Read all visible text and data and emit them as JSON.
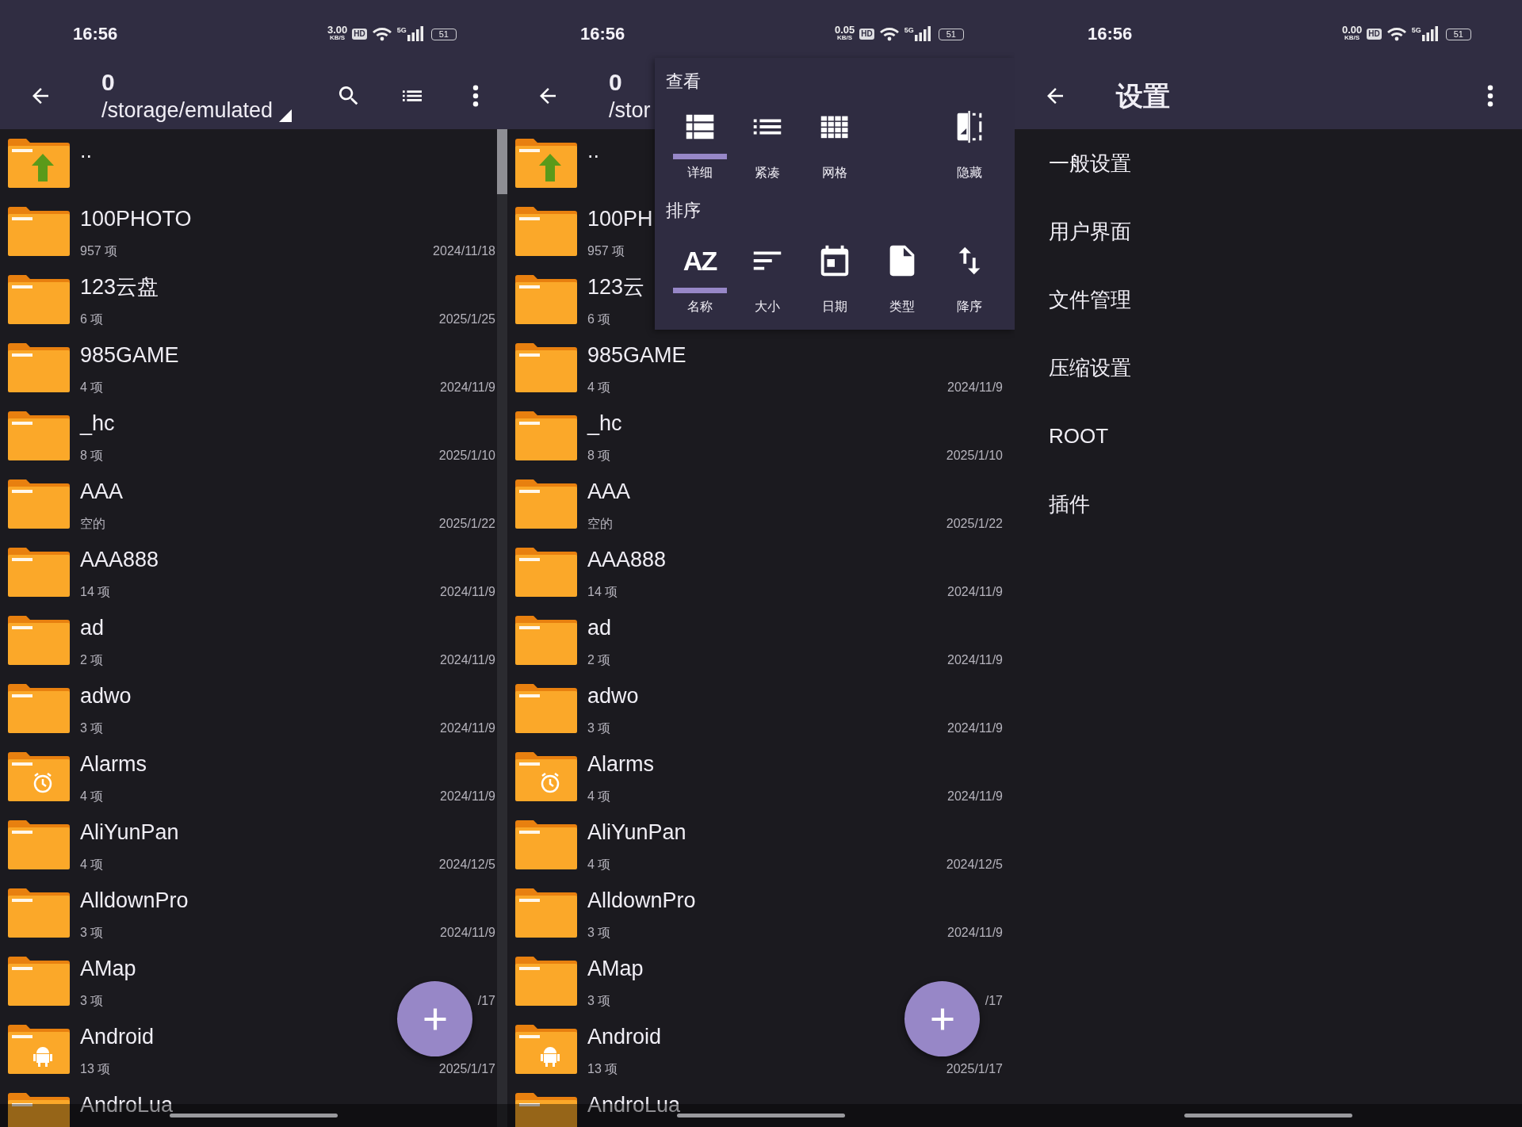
{
  "screens": [
    {
      "kind": "browser",
      "scrollbar": true,
      "status_bar": {
        "time": "16:56",
        "speed": "3.00",
        "speed_unit": "KB/S",
        "hd": "HD",
        "network": "5G",
        "battery": "51"
      },
      "app_bar": {
        "title": "0",
        "path": "/storage/emulated",
        "dropdown": true,
        "actions": [
          {
            "kind": "search"
          },
          {
            "kind": "view"
          },
          {
            "kind": "more"
          }
        ]
      },
      "items": [
        {
          "kind": "up",
          "name": ".."
        },
        {
          "kind": "folder",
          "name": "100PHOTO",
          "count": "957 项",
          "date": "2024/11/18"
        },
        {
          "kind": "folder",
          "name": "123云盘",
          "count": "6 项",
          "date": "2025/1/25"
        },
        {
          "kind": "folder",
          "name": "985GAME",
          "count": "4 项",
          "date": "2024/11/9"
        },
        {
          "kind": "folder",
          "name": "_hc",
          "count": "8 项",
          "date": "2025/1/10"
        },
        {
          "kind": "folder",
          "name": "AAA",
          "count": "空的",
          "date": "2025/1/22"
        },
        {
          "kind": "folder",
          "name": "AAA888",
          "count": "14 项",
          "date": "2024/11/9"
        },
        {
          "kind": "folder",
          "name": "ad",
          "count": "2 项",
          "date": "2024/11/9"
        },
        {
          "kind": "folder",
          "name": "adwo",
          "count": "3 项",
          "date": "2024/11/9"
        },
        {
          "kind": "clock",
          "name": "Alarms",
          "count": "4 项",
          "date": "2024/11/9"
        },
        {
          "kind": "folder",
          "name": "AliYunPan",
          "count": "4 项",
          "date": "2024/12/5"
        },
        {
          "kind": "folder",
          "name": "AlldownPro",
          "count": "3 项",
          "date": "2024/11/9"
        },
        {
          "kind": "folder",
          "name": "AMap",
          "count": "3 项",
          "date": "/17"
        },
        {
          "kind": "android",
          "name": "Android",
          "count": "13 项",
          "date": "2025/1/17"
        },
        {
          "kind": "folder",
          "name": "AndroLua"
        }
      ],
      "fab": true
    },
    {
      "kind": "browser",
      "status_bar": {
        "time": "16:56",
        "speed": "0.05",
        "speed_unit": "KB/S",
        "hd": "HD",
        "network": "5G",
        "battery": "51"
      },
      "app_bar": {
        "title": "0",
        "path": "/stor"
      },
      "items": [
        {
          "kind": "up",
          "name": ".."
        },
        {
          "kind": "folder",
          "name": "100PH",
          "count": "957 项"
        },
        {
          "kind": "folder",
          "name": "123云",
          "count": "6 项"
        },
        {
          "kind": "folder",
          "name": "985GAME",
          "count": "4 项",
          "date": "2024/11/9"
        },
        {
          "kind": "folder",
          "name": "_hc",
          "count": "8 项",
          "date": "2025/1/10"
        },
        {
          "kind": "folder",
          "name": "AAA",
          "count": "空的",
          "date": "2025/1/22"
        },
        {
          "kind": "folder",
          "name": "AAA888",
          "count": "14 项",
          "date": "2024/11/9"
        },
        {
          "kind": "folder",
          "name": "ad",
          "count": "2 项",
          "date": "2024/11/9"
        },
        {
          "kind": "folder",
          "name": "adwo",
          "count": "3 项",
          "date": "2024/11/9"
        },
        {
          "kind": "clock",
          "name": "Alarms",
          "count": "4 项",
          "date": "2024/11/9"
        },
        {
          "kind": "folder",
          "name": "AliYunPan",
          "count": "4 项",
          "date": "2024/12/5"
        },
        {
          "kind": "folder",
          "name": "AlldownPro",
          "count": "3 项",
          "date": "2024/11/9"
        },
        {
          "kind": "folder",
          "name": "AMap",
          "count": "3 项",
          "date": "/17"
        },
        {
          "kind": "android",
          "name": "Android",
          "count": "13 项",
          "date": "2025/1/17"
        },
        {
          "kind": "folder",
          "name": "AndroLua"
        }
      ],
      "fab": true,
      "popup": {
        "sections": [
          {
            "title": "查看",
            "options": [
              {
                "kind": "details",
                "label": "详细",
                "selected": true
              },
              {
                "kind": "compact",
                "label": "紧凑",
                "selected": false
              },
              {
                "kind": "grid",
                "label": "网格",
                "selected": false
              },
              {
                "kind": "hide",
                "label": "隐藏",
                "selected": false
              }
            ]
          },
          {
            "title": "排序",
            "options": [
              {
                "kind": "name",
                "glyph": "AZ",
                "label": "名称",
                "selected": true
              },
              {
                "kind": "size",
                "label": "大小",
                "selected": false
              },
              {
                "kind": "date",
                "label": "日期",
                "selected": false
              },
              {
                "kind": "type",
                "label": "类型",
                "selected": false
              },
              {
                "kind": "order",
                "label": "降序",
                "selected": false
              }
            ]
          }
        ]
      }
    },
    {
      "kind": "settings",
      "status_bar": {
        "time": "16:56",
        "speed": "0.00",
        "speed_unit": "KB/S",
        "hd": "HD",
        "network": "5G",
        "battery": "51"
      },
      "app_bar": {
        "title": "设置",
        "actions": [
          {
            "kind": "more"
          }
        ]
      },
      "items": [
        {
          "label": "一般设置"
        },
        {
          "label": "用户界面"
        },
        {
          "label": "文件管理"
        },
        {
          "label": "压缩设置"
        },
        {
          "label": "ROOT"
        },
        {
          "label": "插件"
        }
      ]
    }
  ]
}
